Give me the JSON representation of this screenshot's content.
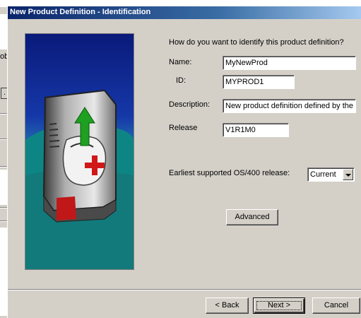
{
  "background": {
    "left_text": "ob",
    "left_box": "."
  },
  "dialog": {
    "title": "New Product Definition - Identification",
    "question": "How do you want to identify this product definition?",
    "name": {
      "label": "Name:",
      "value": "MyNewProd"
    },
    "id": {
      "label": "ID:",
      "value": "MYPROD1"
    },
    "description": {
      "label": "Description:",
      "value": "New product definition defined by the u"
    },
    "release": {
      "label": "Release",
      "value": "V1R1M0"
    },
    "earliest": {
      "label": "Earliest supported OS/400 release:",
      "value": "Current"
    },
    "buttons": {
      "advanced": "Advanced",
      "back": "< Back",
      "next": "Next >",
      "cancel": "Cancel"
    }
  },
  "colors": {
    "titlebar": "#0a246a",
    "window": "#d4d0c8",
    "picture_bg": "#0b1f8a",
    "picture_teal": "#008080"
  },
  "icons": {
    "illustration": "product-box-with-upgrade-arrow"
  }
}
